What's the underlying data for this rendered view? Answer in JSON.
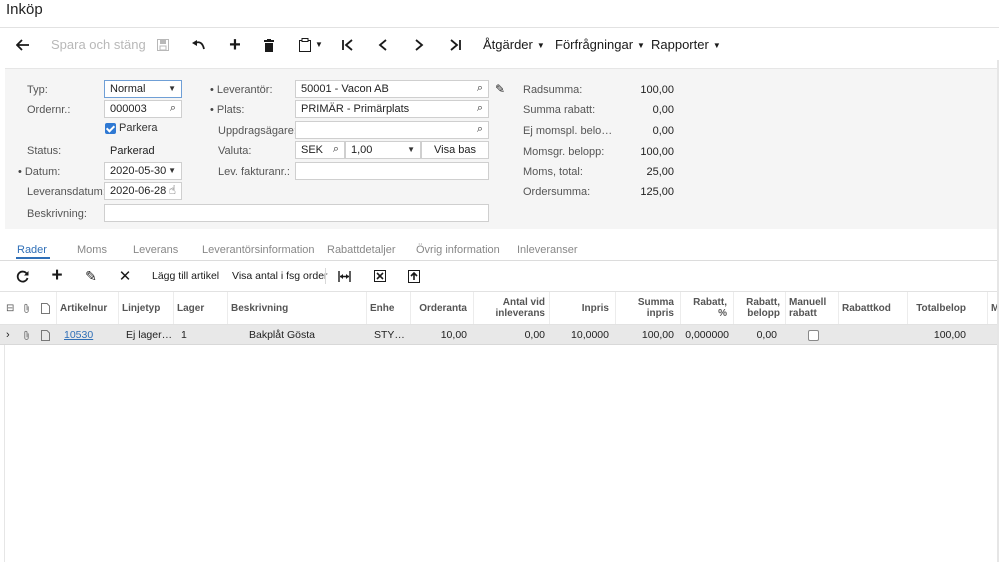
{
  "page": {
    "title": "Inköp"
  },
  "toolbar": {
    "save_close": "Spara och stäng",
    "actions": "Åtgärder",
    "inquiries": "Förfrågningar",
    "reports": "Rapporter"
  },
  "form": {
    "type_label": "Typ:",
    "type_value": "Normal",
    "order_label": "Ordernr.:",
    "order_value": "000003",
    "hold_label": "Parkera",
    "hold_checked": true,
    "status_label": "Status:",
    "status_value": "Parkerad",
    "date_label": "Datum:",
    "date_value": "2020-05-30",
    "delivery_date_label": "Leveransdatum:",
    "delivery_date_value": "2020-06-28",
    "description_label": "Beskrivning:",
    "description_value": "",
    "vendor_label": "Leverantör:",
    "vendor_value": "50001 - Vacon AB",
    "location_label": "Plats:",
    "location_value": "PRIMÄR - Primärplats",
    "owner_label": "Uppdragsägare:",
    "owner_value": "",
    "currency_label": "Valuta:",
    "currency_value": "SEK",
    "rate_value": "1,00",
    "view_base_button": "Visa bas",
    "vendor_ref_label": "Lev. fakturanr.:",
    "vendor_ref_value": ""
  },
  "totals": [
    {
      "label": "Radsumma:",
      "value": "100,00"
    },
    {
      "label": "Summa rabatt:",
      "value": "0,00"
    },
    {
      "label": "Ej momspl. belo…",
      "value": "0,00"
    },
    {
      "label": "Momsgr. belopp:",
      "value": "100,00"
    },
    {
      "label": "Moms, total:",
      "value": "25,00"
    },
    {
      "label": "Ordersumma:",
      "value": "125,00"
    }
  ],
  "tabs": [
    "Rader",
    "Moms",
    "Leverans",
    "Leverantörsinformation",
    "Rabattdetaljer",
    "Övrig information",
    "Inleveranser"
  ],
  "grid_toolbar": {
    "add_item": "Lägg till artikel",
    "show_qty": "Visa antal i fsg order"
  },
  "grid": {
    "columns": [
      "Artikelnur",
      "Linjetyp",
      "Lager",
      "Beskrivning",
      "Enhe",
      "Orderanta",
      "Antal vid inleverans",
      "Inpris",
      "Summa inpris",
      "Rabatt, %",
      "Rabatt, belopp",
      "Manuell rabatt",
      "Rabattkod",
      "Totalbelop",
      "M"
    ],
    "rows": [
      {
        "item": "10530",
        "line_type": "Ej lager…",
        "warehouse": "1",
        "description": "Bakplåt Gösta",
        "uom": "STY…",
        "order_qty": "10,00",
        "received_qty": "0,00",
        "unit_cost": "10,0000",
        "ext_cost": "100,00",
        "discount_pct": "0,000000",
        "discount_amt": "0,00",
        "manual_discount": false,
        "discount_code": "",
        "total": "100,00"
      }
    ]
  }
}
